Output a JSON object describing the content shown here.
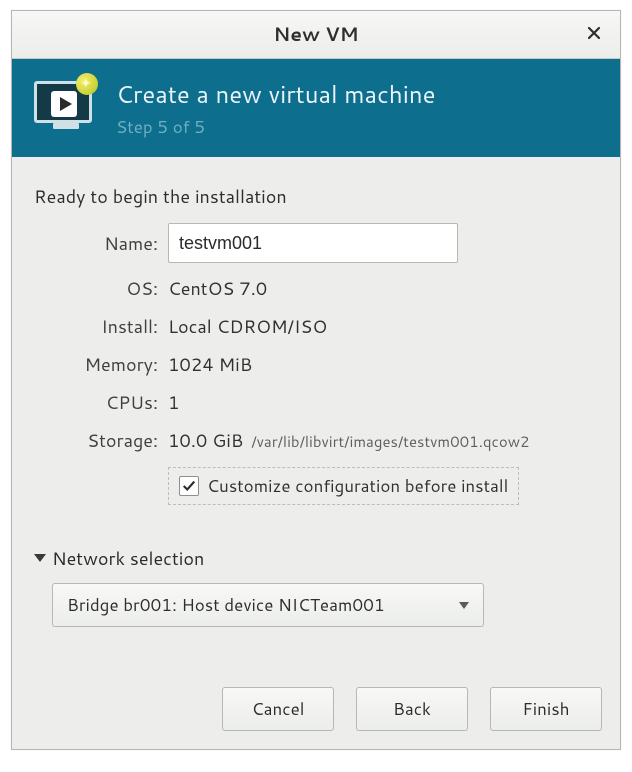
{
  "window": {
    "title": "New VM"
  },
  "banner": {
    "heading": "Create a new virtual machine",
    "step": "Step 5 of 5"
  },
  "lead": "Ready to begin the installation",
  "fields": {
    "name_label": "Name:",
    "name_value": "testvm001",
    "os_label": "OS:",
    "os_value": "CentOS 7.0",
    "install_label": "Install:",
    "install_value": "Local CDROM/ISO",
    "memory_label": "Memory:",
    "memory_value": "1024 MiB",
    "cpus_label": "CPUs:",
    "cpus_value": "1",
    "storage_label": "Storage:",
    "storage_value": "10.0 GiB",
    "storage_path": "/var/lib/libvirt/images/testvm001.qcow2"
  },
  "customize": {
    "checked": true,
    "label": "Customize configuration before install"
  },
  "network": {
    "section_label": "Network selection",
    "selected": "Bridge br001: Host device NICTeam001"
  },
  "buttons": {
    "cancel": "Cancel",
    "back": "Back",
    "finish": "Finish"
  },
  "colors": {
    "banner": "#0e6e8e"
  }
}
